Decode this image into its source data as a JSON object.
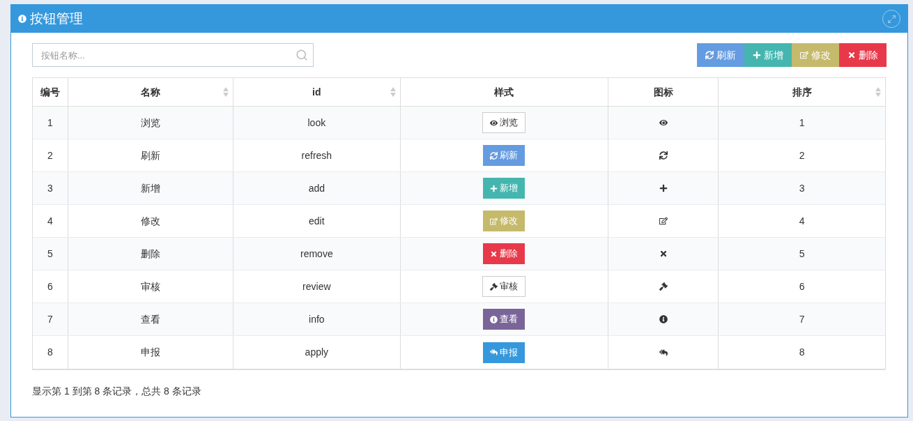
{
  "panel": {
    "title": "按钮管理"
  },
  "search": {
    "placeholder": "按钮名称..."
  },
  "toolbar": [
    {
      "label": "刷新",
      "kind": "refresh",
      "color": "#659be0"
    },
    {
      "label": "新增",
      "kind": "add",
      "color": "#45b6af"
    },
    {
      "label": "修改",
      "kind": "edit",
      "color": "#c5b96b"
    },
    {
      "label": "删除",
      "kind": "remove",
      "color": "#e7394a"
    }
  ],
  "table": {
    "columns": [
      {
        "label": "编号",
        "sortable": false
      },
      {
        "label": "名称",
        "sortable": true
      },
      {
        "label": "id",
        "sortable": true
      },
      {
        "label": "样式",
        "sortable": false
      },
      {
        "label": "图标",
        "sortable": false
      },
      {
        "label": "排序",
        "sortable": true
      }
    ],
    "rows": [
      {
        "number": "1",
        "name": "浏览",
        "id": "look",
        "style_label": "浏览",
        "kind": "view",
        "color": "#ffffff",
        "order": "1"
      },
      {
        "number": "2",
        "name": "刷新",
        "id": "refresh",
        "style_label": "刷新",
        "kind": "refresh",
        "color": "#659be0",
        "order": "2"
      },
      {
        "number": "3",
        "name": "新增",
        "id": "add",
        "style_label": "新增",
        "kind": "add",
        "color": "#45b6af",
        "order": "3"
      },
      {
        "number": "4",
        "name": "修改",
        "id": "edit",
        "style_label": "修改",
        "kind": "edit",
        "color": "#c5b96b",
        "order": "4"
      },
      {
        "number": "5",
        "name": "删除",
        "id": "remove",
        "style_label": "删除",
        "kind": "remove",
        "color": "#e7394a",
        "order": "5"
      },
      {
        "number": "6",
        "name": "审核",
        "id": "review",
        "style_label": "审核",
        "kind": "review",
        "color": "#ffffff",
        "order": "6"
      },
      {
        "number": "7",
        "name": "查看",
        "id": "info",
        "style_label": "查看",
        "kind": "info",
        "color": "#7a6599",
        "order": "7"
      },
      {
        "number": "8",
        "name": "申报",
        "id": "apply",
        "style_label": "申报",
        "kind": "apply",
        "color": "#3598dc",
        "order": "8"
      }
    ]
  },
  "footer": {
    "summary": "显示第 1 到第 8 条记录，总共 8 条记录"
  }
}
